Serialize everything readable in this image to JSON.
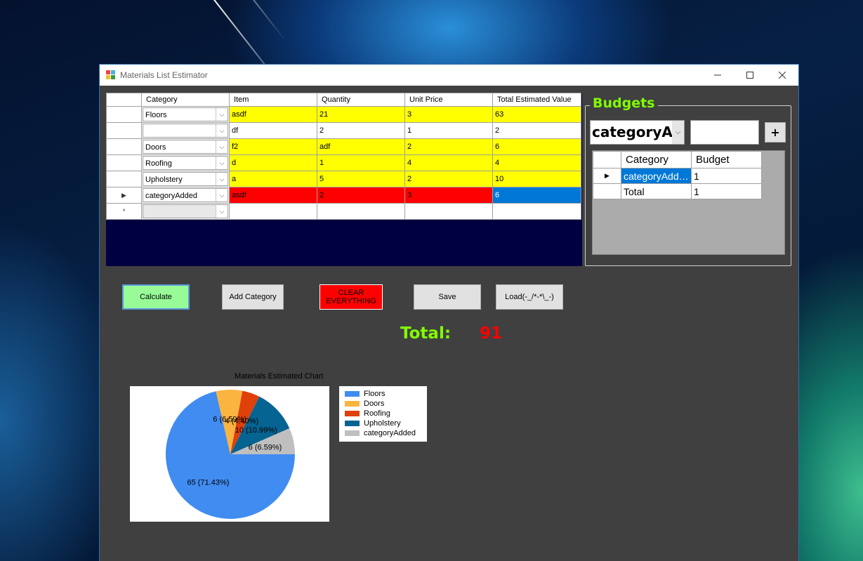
{
  "window": {
    "title": "Materials List Estimator"
  },
  "grid": {
    "columns": [
      "Category",
      "Item",
      "Quantity",
      "Unit Price",
      "Total Estimated Value"
    ],
    "rows": [
      {
        "category": "Floors",
        "item": "asdf",
        "quantity": "21",
        "unit_price": "3",
        "total": "63",
        "style": "yel"
      },
      {
        "category": "",
        "item": "df",
        "quantity": "2",
        "unit_price": "1",
        "total": "2",
        "style": "wht"
      },
      {
        "category": "Doors",
        "item": "f2",
        "quantity": "adf",
        "unit_price": "2",
        "total": "6",
        "style": "yel"
      },
      {
        "category": "Roofing",
        "item": "d",
        "quantity": "1",
        "unit_price": "4",
        "total": "4",
        "style": "yel"
      },
      {
        "category": "Upholstery",
        "item": "a",
        "quantity": "5",
        "unit_price": "2",
        "total": "10",
        "style": "yel"
      },
      {
        "category": "categoryAdded",
        "item": "asdf",
        "quantity": "2",
        "unit_price": "3",
        "total": "6",
        "style": "red",
        "current": true
      }
    ],
    "new_row_marker": "*"
  },
  "budgets": {
    "legend": "Budgets",
    "combo_value": "categoryAdded",
    "input_value": "",
    "add_label": "+",
    "columns": [
      "Category",
      "Budget"
    ],
    "rows": [
      {
        "category": "categoryAdded",
        "budget": "1"
      },
      {
        "category": "Total",
        "budget": "1"
      }
    ]
  },
  "buttons": {
    "calculate": "Calculate",
    "add_category": "Add Category",
    "clear_everything": "CLEAR EVERYTHING",
    "save": "Save",
    "load": "Load(-_/*-*\\_-)"
  },
  "total": {
    "label": "Total:",
    "value": "91"
  },
  "colors": {
    "accent_green": "#80ff00",
    "total_red": "#ff0000",
    "calculate_bg": "#98fb98",
    "clear_bg": "#ff0000"
  },
  "chart_data": {
    "type": "pie",
    "title": "Materials Estimated Chart",
    "slices": [
      {
        "name": "Floors",
        "value": 65,
        "label": "65 (71.43%)",
        "color": "#418cf0"
      },
      {
        "name": "Doors",
        "value": 6,
        "label": "6 (6.59%)",
        "color": "#fcb441"
      },
      {
        "name": "Roofing",
        "value": 4,
        "label": "4 (4.40%)",
        "color": "#e0400a"
      },
      {
        "name": "Upholstery",
        "value": 10,
        "label": "10 (10.99%)",
        "color": "#056492"
      },
      {
        "name": "categoryAdded",
        "value": 6,
        "label": "6 (6.59%)",
        "color": "#bfbfbf"
      }
    ],
    "legend_position": "right"
  }
}
